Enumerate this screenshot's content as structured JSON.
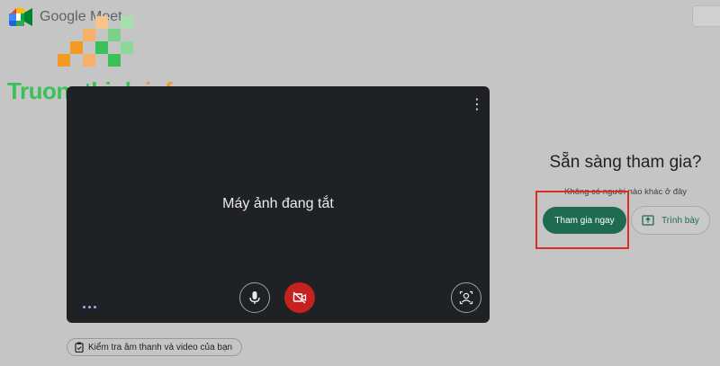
{
  "header": {
    "brand": "Google Meet",
    "logo_icon": "google-meet-logo-icon"
  },
  "watermark": {
    "name_part1": "Truongthinh",
    "name_part2": ".info",
    "colors": {
      "green": "#3cc05a",
      "orange": "#f39a25"
    }
  },
  "preview": {
    "status_text": "Máy ảnh đang tắt",
    "menu_glyph": "⋮",
    "controls": [
      {
        "name": "microphone",
        "icon": "mic-icon",
        "state": "on"
      },
      {
        "name": "camera",
        "icon": "camera-off-icon",
        "state": "off"
      },
      {
        "name": "visual-effects",
        "icon": "effects-icon"
      }
    ]
  },
  "check_av": {
    "label": "Kiểm tra âm thanh và video của bạn",
    "icon": "clipboard-check-icon"
  },
  "join_panel": {
    "title": "Sẵn sàng tham gia?",
    "subtitle": "Không có người nào khác ở đây",
    "join_label": "Tham gia ngay",
    "present_label": "Trình bày",
    "present_icon": "present-screen-icon"
  },
  "colors": {
    "page_bg": "#c5c5c5",
    "video_bg": "#202124",
    "camera_off_red": "#c5221f",
    "join_green": "#1e6b52",
    "highlight_red": "#d93025"
  }
}
